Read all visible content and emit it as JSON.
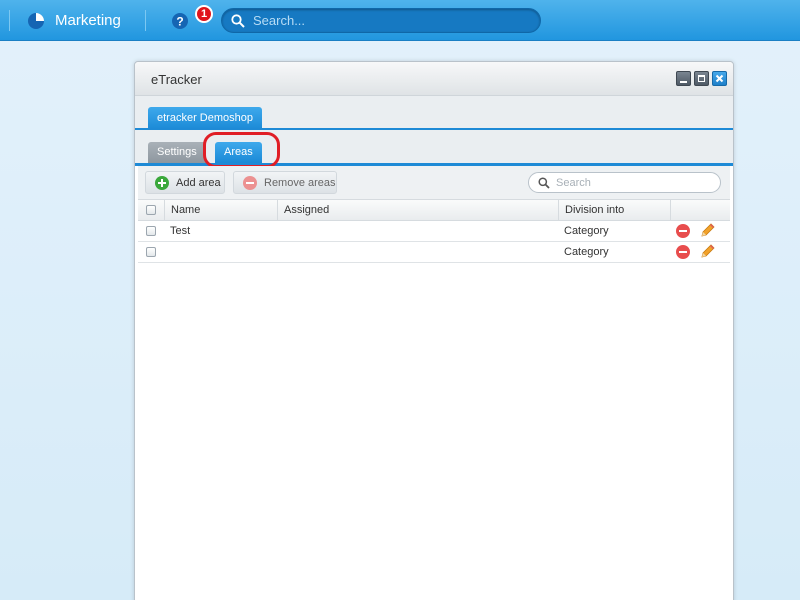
{
  "topbar": {
    "app_title": "Marketing",
    "app_icon": "pie-chart-icon",
    "help_icon": "help-icon",
    "notification_count": "1",
    "search_placeholder": "Search..."
  },
  "window": {
    "title": "eTracker",
    "controls": [
      "minimize",
      "maximize",
      "close"
    ],
    "shop_tab": "etracker Demoshop",
    "tabs": [
      {
        "label": "Settings",
        "active": false
      },
      {
        "label": "Areas",
        "active": true
      }
    ]
  },
  "toolbar": {
    "add_label": "Add area",
    "remove_label": "Remove areas",
    "search_placeholder": "Search"
  },
  "grid": {
    "columns": [
      "Name",
      "Assigned",
      "Division into"
    ],
    "rows": [
      {
        "name": "Test",
        "assigned": "",
        "division": "Category"
      },
      {
        "name": "",
        "assigned": "",
        "division": "Category"
      }
    ]
  },
  "colors": {
    "accent": "#1e8ad6",
    "highlight": "#e01e26",
    "notification": "#e0141b"
  }
}
